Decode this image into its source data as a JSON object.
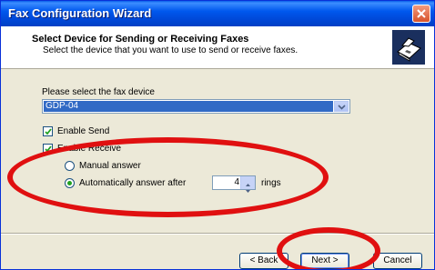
{
  "window": {
    "title": "Fax Configuration Wizard"
  },
  "header": {
    "title": "Select Device for Sending or Receiving Faxes",
    "subtitle": "Select the device that you want to use to send or receive faxes."
  },
  "form": {
    "device_label": "Please select the fax device",
    "device_value": "GDP-04",
    "enable_send_label": "Enable Send",
    "enable_send_checked": true,
    "enable_receive_label": "Enable Receive",
    "enable_receive_checked": true,
    "manual_answer_label": "Manual answer",
    "auto_answer_label": "Automatically answer after",
    "rings_value": "4",
    "rings_label": "rings",
    "selected_answer_mode": "auto"
  },
  "buttons": {
    "back": "< Back",
    "next": "Next >",
    "cancel": "Cancel"
  },
  "colors": {
    "title_bar": "#0058ee",
    "selection": "#316ac5",
    "annotation": "#e01010"
  }
}
